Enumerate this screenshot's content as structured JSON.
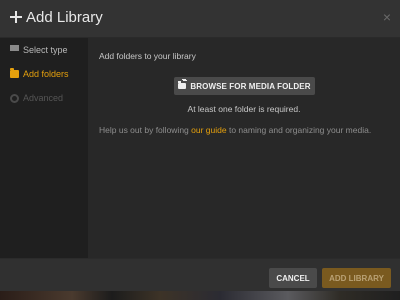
{
  "dialog": {
    "title": "Add Library",
    "close_glyph": "×"
  },
  "sidebar": {
    "items": [
      {
        "label": "Select type",
        "icon": "list-icon",
        "state": "completed"
      },
      {
        "label": "Add folders",
        "icon": "folder-icon",
        "state": "active"
      },
      {
        "label": "Advanced",
        "icon": "gear-icon",
        "state": "disabled"
      }
    ]
  },
  "main": {
    "instructions": "Add folders to your library",
    "browse_label": "BROWSE FOR MEDIA FOLDER",
    "requirement": "At least one folder is required.",
    "help_prefix": "Help us out by following ",
    "help_link": "our guide",
    "help_suffix": " to naming and organizing your media."
  },
  "footer": {
    "cancel_label": "CANCEL",
    "add_label": "ADD LIBRARY",
    "add_enabled": false
  },
  "colors": {
    "accent": "#e5a00d",
    "dialog_bg": "#282828",
    "sidebar_bg": "#1f1f1f",
    "button_bg": "#4a4a4a"
  }
}
